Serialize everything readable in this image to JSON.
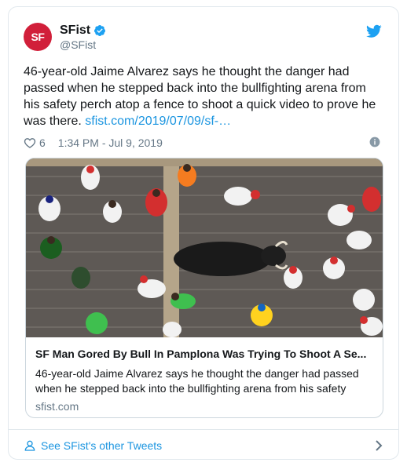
{
  "account": {
    "logo_text": "SF",
    "display_name": "SFist",
    "handle": "@SFist"
  },
  "tweet": {
    "text": "46-year-old Jaime Alvarez says he thought the danger had passed when he stepped back into the bullfighting arena from his safety perch atop a fence to shoot a quick video to prove he was there.",
    "link_text": "sfist.com/2019/07/09/sf-…",
    "like_count": "6",
    "timestamp": "1:34 PM - Jul 9, 2019"
  },
  "card": {
    "title": "SF Man Gored By Bull In Pamplona Was Trying To Shoot A Se...",
    "description": "46-year-old Jaime Alvarez says he thought the danger had passed when he stepped back into the bullfighting arena from his safety",
    "domain": "sfist.com"
  },
  "footer": {
    "link_text": "See SFist's other Tweets"
  },
  "colors": {
    "brand_red": "#d11f3a",
    "link_blue": "#1b95e0",
    "muted_gray": "#657786"
  },
  "icons": [
    "verified-badge-icon",
    "twitter-bird-icon",
    "heart-icon",
    "info-icon",
    "person-icon",
    "chevron-right-icon"
  ]
}
